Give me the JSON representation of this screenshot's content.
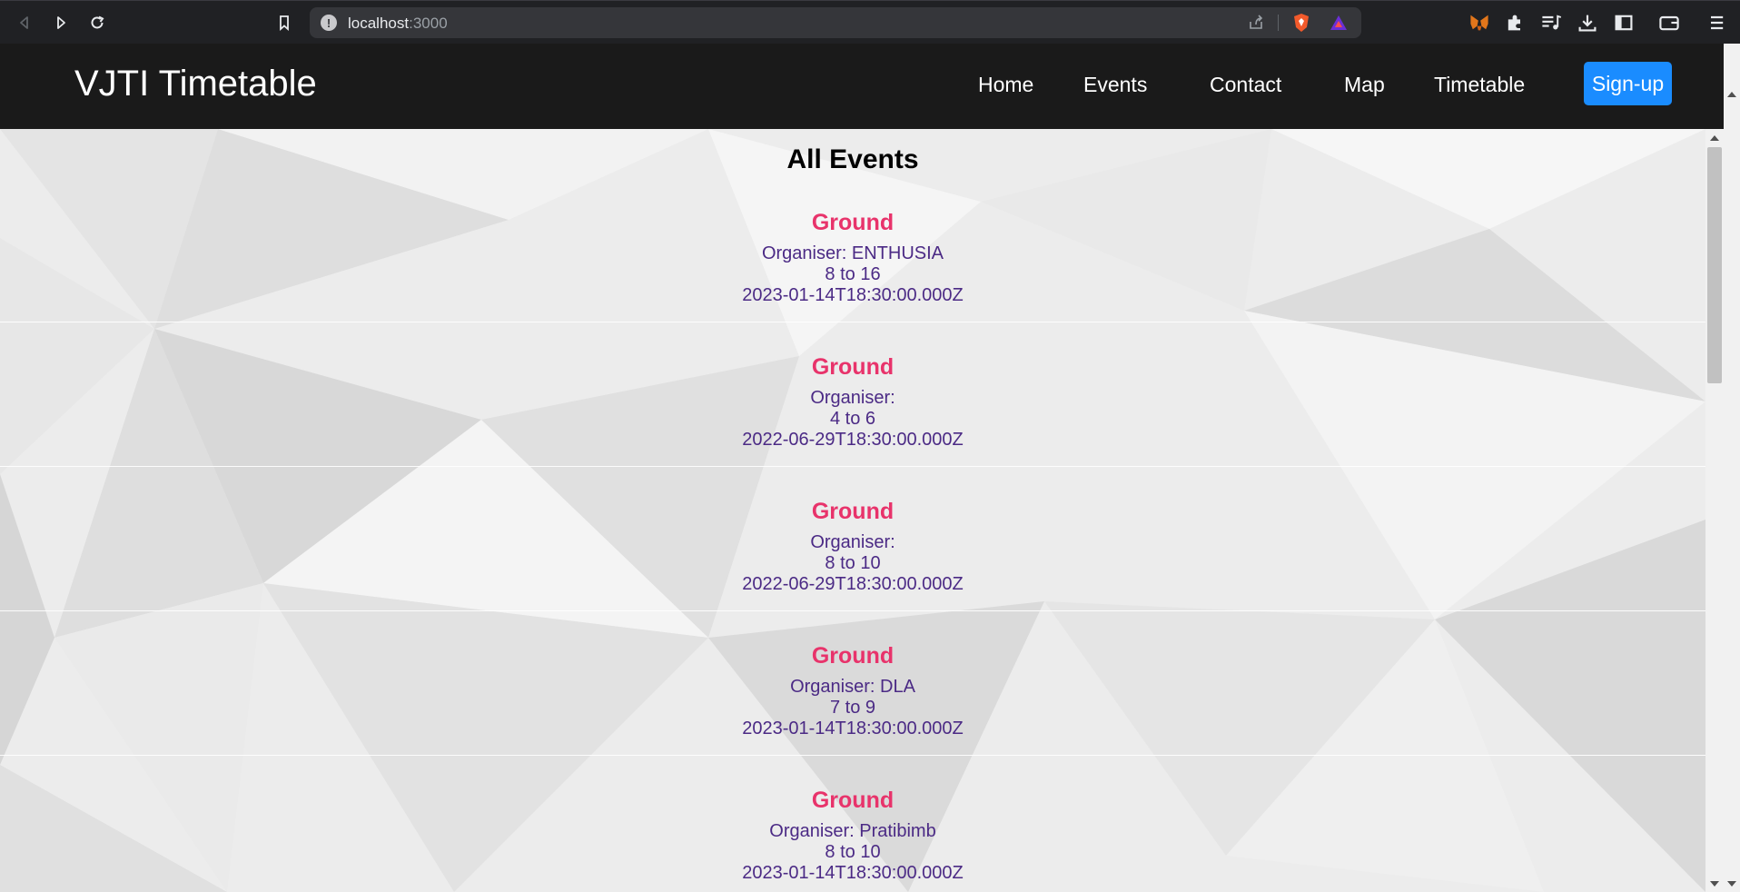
{
  "browser": {
    "url_host": "localhost",
    "url_port": ":3000"
  },
  "navbar": {
    "brand": "VJTI Timetable",
    "links": [
      "Home",
      "Events",
      "Contact",
      "Map",
      "Timetable"
    ],
    "signup": "Sign-up"
  },
  "main": {
    "heading": "All Events",
    "events": [
      {
        "title": "Ground",
        "organiser": "Organiser: ENTHUSIA",
        "time": "8 to 16",
        "date": "2023-01-14T18:30:00.000Z"
      },
      {
        "title": "Ground",
        "organiser": "Organiser:",
        "time": "4 to 6",
        "date": "2022-06-29T18:30:00.000Z"
      },
      {
        "title": "Ground",
        "organiser": "Organiser:",
        "time": "8 to 10",
        "date": "2022-06-29T18:30:00.000Z"
      },
      {
        "title": "Ground",
        "organiser": "Organiser: DLA",
        "time": "7 to 9",
        "date": "2023-01-14T18:30:00.000Z"
      },
      {
        "title": "Ground",
        "organiser": "Organiser: Pratibimb",
        "time": "8 to 10",
        "date": "2023-01-14T18:30:00.000Z"
      }
    ]
  },
  "colors": {
    "navbar_bg": "#1a1a1a",
    "signup_bg": "#1a8cff",
    "event_title": "#e8336b",
    "event_text": "#4b2a85"
  }
}
